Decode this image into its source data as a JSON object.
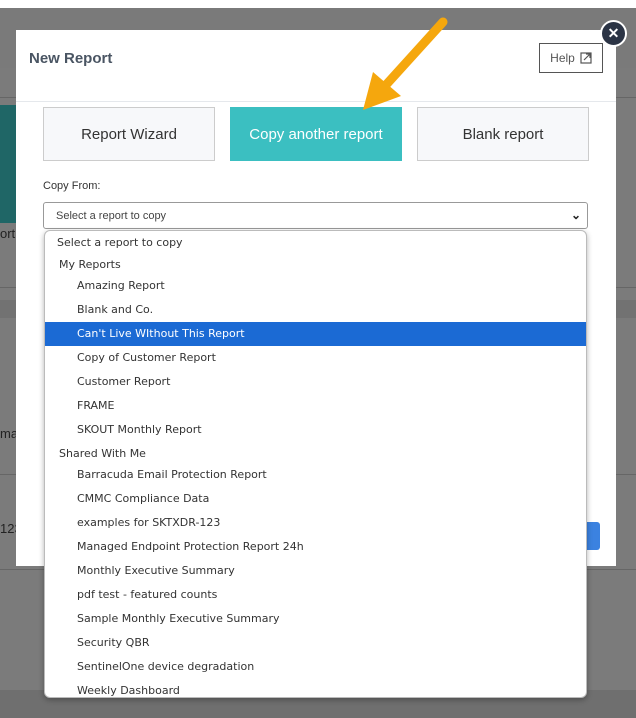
{
  "dialog": {
    "title": "New Report",
    "help_label": "Help",
    "help_icon": "external-link-icon",
    "close_icon": "close-icon"
  },
  "options": [
    {
      "label": "Report Wizard",
      "active": false
    },
    {
      "label": "Copy another report",
      "active": true
    },
    {
      "label": "Blank report",
      "active": false
    }
  ],
  "copy_from": {
    "label": "Copy From:",
    "value": "Select a report to copy"
  },
  "dropdown": {
    "placeholder": "Select a report to copy",
    "groups": [
      {
        "label": "My Reports",
        "items": [
          "Amazing Report",
          "Blank and Co.",
          "Can't Live WIthout This Report",
          "Copy of Customer Report",
          "Customer Report",
          "FRAME",
          "SKOUT Monthly Report"
        ]
      },
      {
        "label": "Shared With Me",
        "items": [
          "Barracuda Email Protection Report",
          "CMMC Compliance Data",
          "examples for SKTXDR-123",
          "Managed Endpoint Protection Report 24h",
          "Monthly Executive Summary",
          "pdf test - featured counts",
          "Sample Monthly Executive Summary",
          "Security QBR",
          "SentinelOne device degradation",
          "Weekly Dashboard"
        ]
      }
    ],
    "highlighted": "Can't Live WIthout This Report"
  },
  "background": {
    "fragments": [
      "ort",
      "ma",
      "123"
    ]
  },
  "colors": {
    "accent": "#3bbfc1",
    "highlight": "#1b6ad4",
    "annotation_arrow": "#f5a70d"
  }
}
